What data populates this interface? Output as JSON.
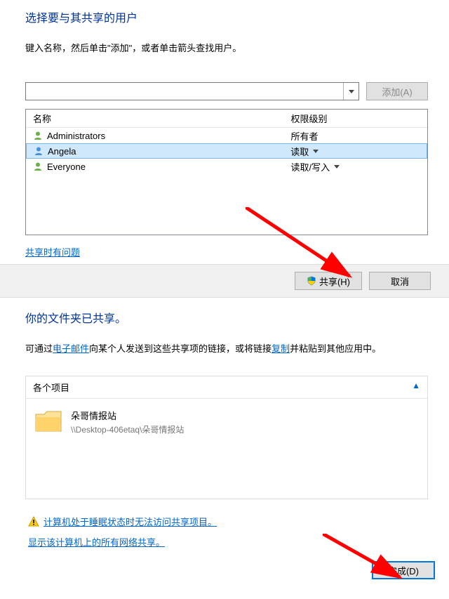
{
  "panel1": {
    "title": "选择要与其共享的用户",
    "desc": "键入名称，然后单击\"添加\"，或者单击箭头查找用户。",
    "add_button": "添加(A)",
    "columns": {
      "name": "名称",
      "perm": "权限级别"
    },
    "rows": [
      {
        "name": "Administrators",
        "perm": "所有者",
        "icon": "group",
        "dropdown": false,
        "selected": false
      },
      {
        "name": "Angela",
        "perm": "读取",
        "icon": "user",
        "dropdown": true,
        "selected": true
      },
      {
        "name": "Everyone",
        "perm": "读取/写入",
        "icon": "group",
        "dropdown": true,
        "selected": false
      }
    ],
    "help_link": "共享时有问题",
    "share_button": "共享(H)",
    "cancel_button": "取消"
  },
  "panel2": {
    "title": "你的文件夹已共享。",
    "desc_pre": "可通过",
    "desc_link1": "电子邮件",
    "desc_mid": "向某个人发送到这些共享项的链接，或将链接",
    "desc_link2": "复制",
    "desc_post": "并粘贴到其他应用中。",
    "items_label": "各个项目",
    "item_name": "朵哥情报站",
    "item_path": "\\\\Desktop-406etaq\\朵哥情报站",
    "warning_link": "计算机处于睡眠状态时无法访问共享项目。",
    "show_all_link": "显示该计算机上的所有网络共享。",
    "done_button": "完成(D)"
  }
}
